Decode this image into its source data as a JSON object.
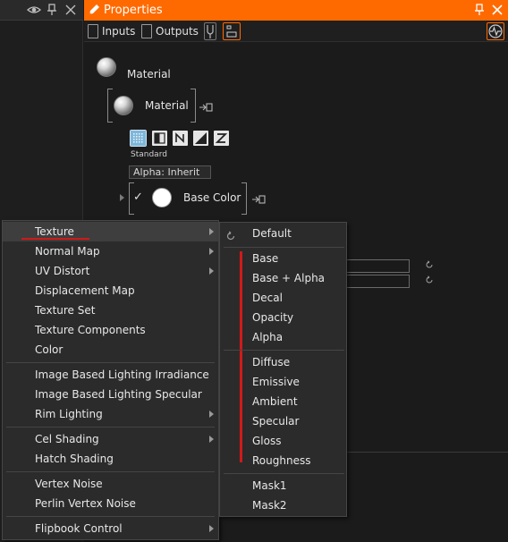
{
  "left_panel": {
    "buttons": {
      "visibility_icon": "eye-icon",
      "pin_icon": "pin-icon",
      "close_icon": "close-icon"
    }
  },
  "properties": {
    "title": "Properties",
    "toolbar": {
      "inputs_label": "Inputs",
      "outputs_label": "Outputs"
    },
    "material_header_label": "Material",
    "material_node_label": "Material",
    "shading_mode_label": "Standard",
    "alpha_label": "Alpha:  Inherit",
    "base_color_label": "Base Color",
    "base_color_check": "✓"
  },
  "context_menu": {
    "items": [
      {
        "label": "Texture",
        "submenu": true,
        "highlighted": true
      },
      {
        "label": "Normal Map",
        "submenu": true
      },
      {
        "label": "UV Distort",
        "submenu": true
      },
      {
        "label": "Displacement Map",
        "submenu": false
      },
      {
        "label": "Texture Set",
        "submenu": false
      },
      {
        "label": "Texture Components",
        "submenu": false
      },
      {
        "label": "Color",
        "submenu": false
      },
      {
        "label": "Image Based Lighting Irradiance",
        "submenu": false
      },
      {
        "label": "Image Based Lighting Specular",
        "submenu": false
      },
      {
        "label": "Rim Lighting",
        "submenu": true
      },
      {
        "label": "Cel Shading",
        "submenu": true
      },
      {
        "label": "Hatch Shading",
        "submenu": false
      },
      {
        "label": "Vertex Noise",
        "submenu": false
      },
      {
        "label": "Perlin Vertex Noise",
        "submenu": false
      },
      {
        "label": "Flipbook Control",
        "submenu": true
      }
    ]
  },
  "submenu": {
    "default_label": "Default",
    "items": [
      "Base",
      "Base + Alpha",
      "Decal",
      "Opacity",
      "Alpha",
      "Diffuse",
      "Emissive",
      "Ambient",
      "Specular",
      "Gloss",
      "Roughness",
      "Mask1",
      "Mask2"
    ]
  },
  "colors": {
    "accent": "#ff6a00",
    "highlight_underline": "#d11919",
    "menu_bg": "#2b2b2b"
  }
}
